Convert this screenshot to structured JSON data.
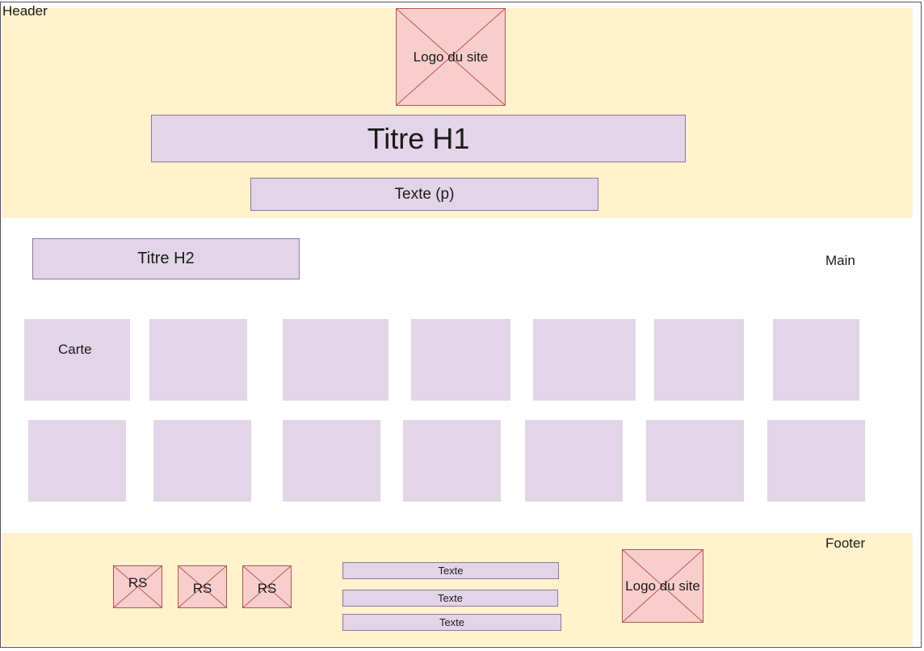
{
  "header": {
    "label": "Header",
    "logo": "Logo du site",
    "h1": "Titre H1",
    "paragraph": "Texte (p)"
  },
  "main": {
    "label": "Main",
    "h2": "Titre H2",
    "card_label": "Carte"
  },
  "footer": {
    "label": "Footer",
    "social": [
      "RS",
      "RS",
      "RS"
    ],
    "texts": [
      "Texte",
      "Texte",
      "Texte"
    ],
    "logo": "Logo du site"
  }
}
